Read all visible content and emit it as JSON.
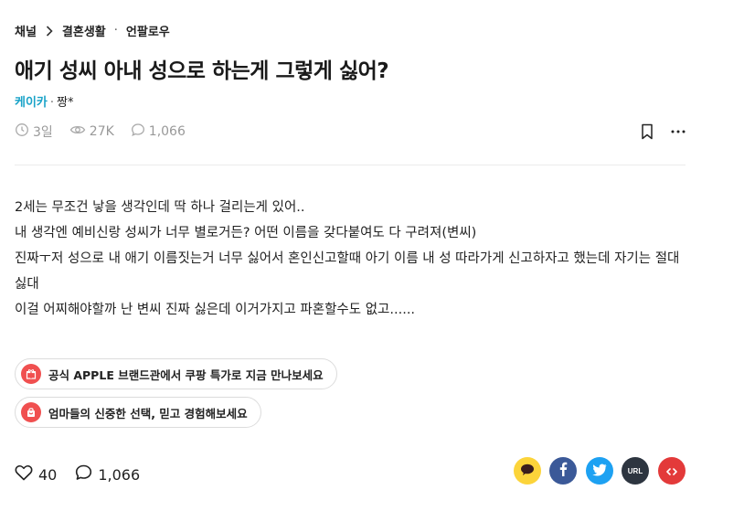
{
  "breadcrumb": {
    "root": "채널",
    "channel": "결혼생활",
    "sub": "언팔로우"
  },
  "post": {
    "title": "애기 성씨 아내 성으로 하는게 그렇게 싫어?",
    "channel_name": "케이카",
    "author": "짱*",
    "time_ago": "3일",
    "views": "27K",
    "comments": "1,066",
    "body_lines": [
      "2세는 무조건 낳을 생각인데 딱 하나 걸리는게 있어..",
      "내 생각엔 예비신랑 성씨가 너무 별로거든? 어떤 이름을 갖다붙여도 다 구려져(변씨)",
      "진짜ㅜ저 성으로 내 애기 이름짓는거 너무 싫어서 혼인신고할때 아기 이름 내 성 따라가게 신고하자고 했는데 자기는 절대 싫대",
      "이걸 어찌해야할까 난 변씨 진짜 싫은데 이거가지고 파혼할수도 없고......"
    ]
  },
  "promos": [
    {
      "label": "공식 APPLE 브랜드관에서 쿠팡 특가로 지금 만나보세요",
      "icon": "gift-icon"
    },
    {
      "label": "엄마들의 신중한 선택, 믿고 경험해보세요",
      "icon": "shopping-bag-icon"
    }
  ],
  "footer": {
    "likes": "40",
    "comments": "1,066"
  },
  "share": {
    "url_label": "URL"
  },
  "colors": {
    "channel": "#1aa3c8",
    "promo_icon": "#f05050",
    "kakao": "#fcd43a",
    "facebook": "#3b5998",
    "twitter": "#1da1f2",
    "url": "#2d3540",
    "embed": "#e33a3a"
  }
}
